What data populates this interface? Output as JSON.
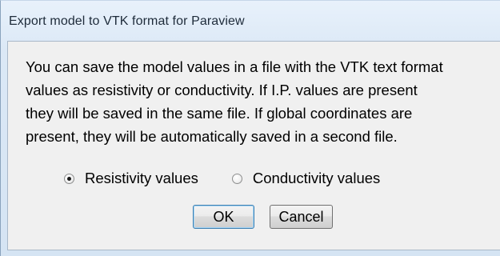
{
  "dialog": {
    "title": "Export model to VTK format for Paraview",
    "message_lines": [
      "You can save the model values in a file with the VTK text format",
      "values as resistivity or conductivity. If I.P. values are present",
      "they will be saved in the same file. If global coordinates are",
      "present, they will be automatically saved in a second file."
    ],
    "options": [
      {
        "label": "Resistivity values",
        "selected": true
      },
      {
        "label": "Conductivity values",
        "selected": false
      }
    ],
    "buttons": {
      "ok_label": "OK",
      "cancel_label": "Cancel"
    }
  },
  "colors": {
    "title_bar": "#dbe8f6",
    "client_bg": "#f0f0f0",
    "default_button_border": "#3c7fb1"
  }
}
